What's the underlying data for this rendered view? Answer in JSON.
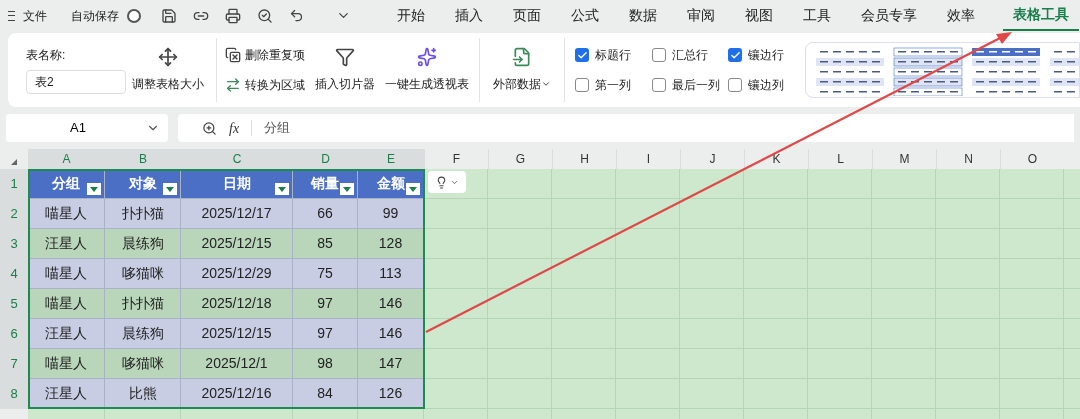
{
  "top_bar": {
    "file_menu": "文件",
    "autosave": {
      "label": "自动保存",
      "on": false
    },
    "tabs": [
      {
        "label": "开始",
        "selected": false
      },
      {
        "label": "插入",
        "selected": false
      },
      {
        "label": "页面",
        "selected": false
      },
      {
        "label": "公式",
        "selected": false
      },
      {
        "label": "数据",
        "selected": false
      },
      {
        "label": "审阅",
        "selected": false
      },
      {
        "label": "视图",
        "selected": false
      },
      {
        "label": "工具",
        "selected": false
      },
      {
        "label": "会员专享",
        "selected": false
      },
      {
        "label": "效率",
        "selected": false
      },
      {
        "label": "表格工具",
        "selected": true
      }
    ]
  },
  "ribbon": {
    "table_name_label": "表名称:",
    "table_name_value": "表2",
    "resize": "调整表格大小",
    "remove_duplicates": "删除重复项",
    "convert_to_range": "转换为区域",
    "insert_slicer": "插入切片器",
    "pivot": "一键生成透视表",
    "external_data": "外部数据",
    "options": [
      {
        "label": "标题行",
        "checked": true
      },
      {
        "label": "汇总行",
        "checked": false
      },
      {
        "label": "镶边行",
        "checked": true
      },
      {
        "label": "第一列",
        "checked": false
      },
      {
        "label": "最后一列",
        "checked": false
      },
      {
        "label": "镶边列",
        "checked": false
      }
    ]
  },
  "formula_bar": {
    "name_box": "A1",
    "function_label": "fx",
    "formula": "分组"
  },
  "sheet": {
    "columns": [
      {
        "label": "A",
        "selected": true
      },
      {
        "label": "B",
        "selected": true
      },
      {
        "label": "C",
        "selected": true
      },
      {
        "label": "D",
        "selected": true
      },
      {
        "label": "E",
        "selected": true
      },
      {
        "label": "F",
        "selected": false
      },
      {
        "label": "G",
        "selected": false
      },
      {
        "label": "H",
        "selected": false
      },
      {
        "label": "I",
        "selected": false
      },
      {
        "label": "J",
        "selected": false
      },
      {
        "label": "K",
        "selected": false
      },
      {
        "label": "L",
        "selected": false
      },
      {
        "label": "M",
        "selected": false
      },
      {
        "label": "N",
        "selected": false
      },
      {
        "label": "O",
        "selected": false
      }
    ],
    "row_headers": [
      {
        "label": "1",
        "selected": true
      },
      {
        "label": "2",
        "selected": true
      },
      {
        "label": "3",
        "selected": true
      },
      {
        "label": "4",
        "selected": true
      },
      {
        "label": "5",
        "selected": true
      },
      {
        "label": "6",
        "selected": true
      },
      {
        "label": "7",
        "selected": true
      },
      {
        "label": "8",
        "selected": true
      }
    ],
    "table": {
      "headers": [
        "分组",
        "对象",
        "日期",
        "销量",
        "金额"
      ],
      "rows": [
        [
          "喵星人",
          "扑扑猫",
          "2025/12/17",
          "66",
          "99"
        ],
        [
          "汪星人",
          "晨练狗",
          "2025/12/15",
          "85",
          "128"
        ],
        [
          "喵星人",
          "哆猫咪",
          "2025/12/29",
          "75",
          "113"
        ],
        [
          "喵星人",
          "扑扑猫",
          "2025/12/18",
          "97",
          "146"
        ],
        [
          "汪星人",
          "晨练狗",
          "2025/12/15",
          "97",
          "146"
        ],
        [
          "喵星人",
          "哆猫咪",
          "2025/12/1",
          "98",
          "147"
        ],
        [
          "汪星人",
          "比熊",
          "2025/12/16",
          "84",
          "126"
        ]
      ]
    }
  }
}
